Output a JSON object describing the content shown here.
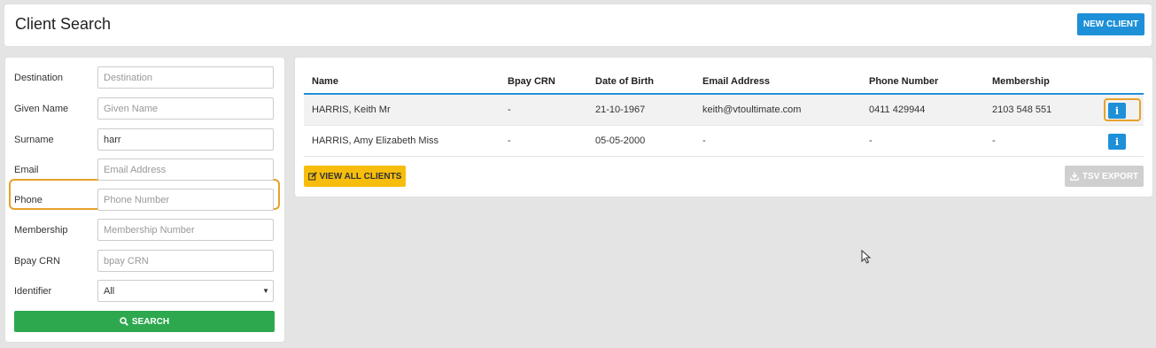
{
  "header": {
    "title": "Client Search",
    "new_client_label": "NEW CLIENT"
  },
  "filters": {
    "destination": {
      "label": "Destination",
      "placeholder": "Destination",
      "value": ""
    },
    "given_name": {
      "label": "Given Name",
      "placeholder": "Given Name",
      "value": ""
    },
    "surname": {
      "label": "Surname",
      "placeholder": "Surname",
      "value": "harr"
    },
    "email": {
      "label": "Email",
      "placeholder": "Email Address",
      "value": ""
    },
    "phone": {
      "label": "Phone",
      "placeholder": "Phone Number",
      "value": ""
    },
    "membership": {
      "label": "Membership",
      "placeholder": "Membership Number",
      "value": ""
    },
    "bpay": {
      "label": "Bpay CRN",
      "placeholder": "bpay CRN",
      "value": ""
    },
    "identifier": {
      "label": "Identifier",
      "selected": "All"
    },
    "search_label": "SEARCH"
  },
  "results": {
    "columns": {
      "name": "Name",
      "bpay": "Bpay CRN",
      "dob": "Date of Birth",
      "email": "Email Address",
      "phone": "Phone Number",
      "membership": "Membership"
    },
    "rows": [
      {
        "name": "HARRIS, Keith Mr",
        "bpay": "-",
        "dob": "21-10-1967",
        "email": "keith@vtoultimate.com",
        "phone": "0411 429944",
        "membership": "2103 548 551"
      },
      {
        "name": "HARRIS, Amy Elizabeth Miss",
        "bpay": "-",
        "dob": "05-05-2000",
        "email": "-",
        "phone": "-",
        "membership": "-"
      }
    ],
    "info_glyph": "i",
    "view_all_label": "VIEW ALL CLIENTS",
    "tsv_export_label": "TSV EXPORT"
  },
  "colors": {
    "primary": "#1e90d8",
    "success": "#2ea84f",
    "warning": "#f6bd0c",
    "highlight": "#e7a22b",
    "disabled": "#cfcfcf"
  }
}
